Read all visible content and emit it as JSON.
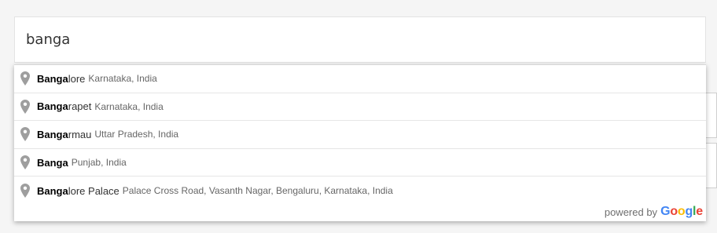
{
  "search": {
    "value": "banga"
  },
  "suggestions": [
    {
      "match": "Banga",
      "rest": "lore",
      "secondary": "Karnataka, India"
    },
    {
      "match": "Banga",
      "rest": "rapet",
      "secondary": "Karnataka, India"
    },
    {
      "match": "Banga",
      "rest": "rmau",
      "secondary": "Uttar Pradesh, India"
    },
    {
      "match": "Banga",
      "rest": "",
      "secondary": "Punjab, India"
    },
    {
      "match": "Banga",
      "rest": "lore Palace",
      "secondary": "Palace Cross Road, Vasanth Nagar, Bengaluru, Karnataka, India"
    }
  ],
  "attribution": {
    "powered_by": "powered by",
    "logo_letters": [
      "G",
      "o",
      "o",
      "g",
      "l",
      "e"
    ],
    "logo_colors": [
      "#4285F4",
      "#EA4335",
      "#FBBC05",
      "#4285F4",
      "#34A853",
      "#EA4335"
    ]
  },
  "icons": {
    "suggestion_icon": "location-pin-icon",
    "pin_color": "#9e9e9e"
  }
}
